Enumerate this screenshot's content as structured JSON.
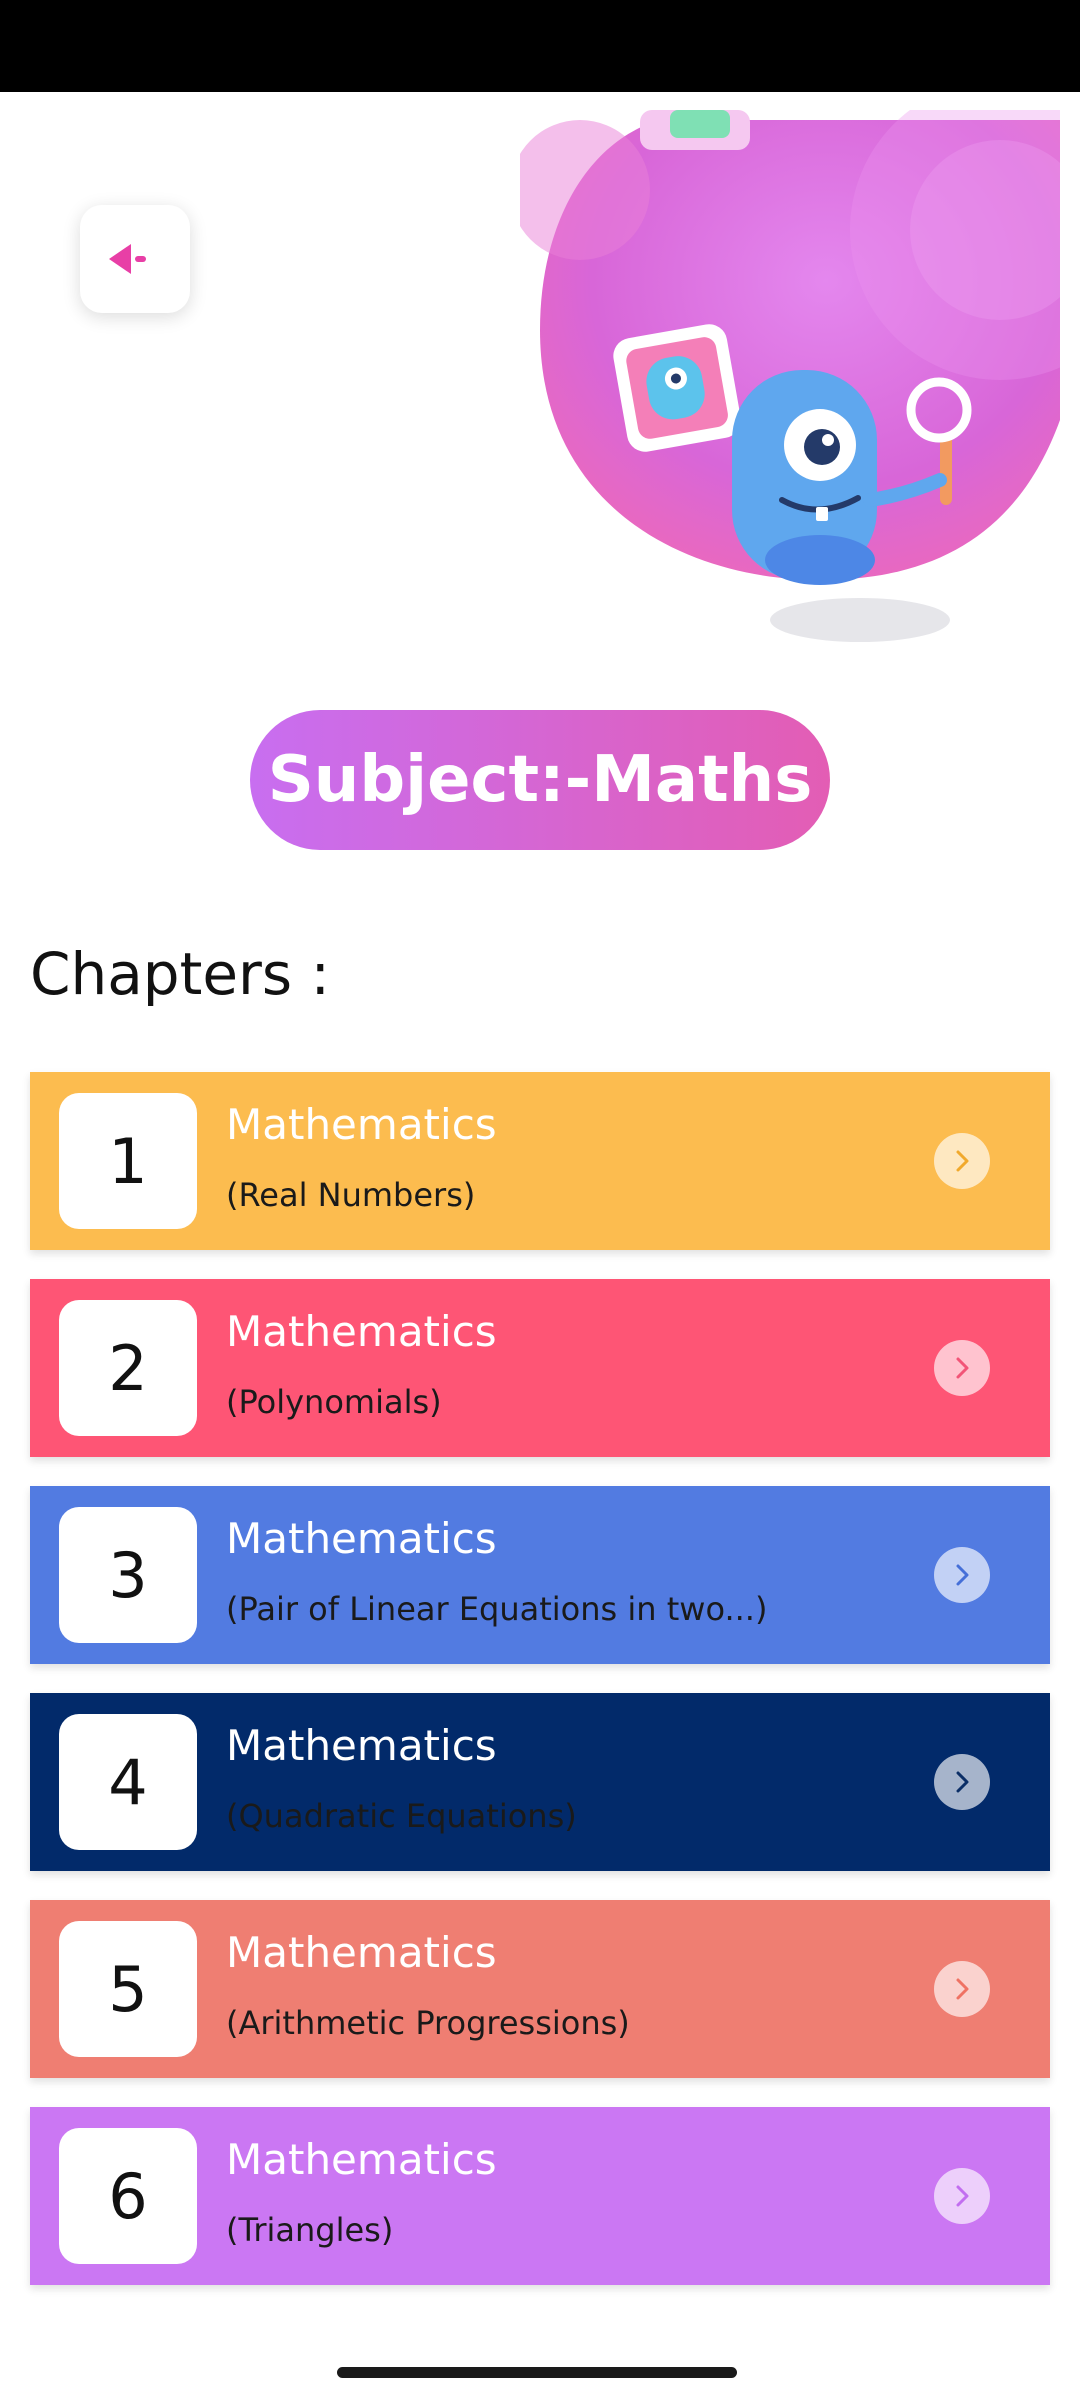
{
  "subject": {
    "label": "Subject:-Maths"
  },
  "chapters_heading": "Chapters :",
  "chapters": [
    {
      "number": "1",
      "title": "Mathematics",
      "subtitle": "(Real Numbers)",
      "color": "#fcbc4f",
      "arrow_color": "#f1a92c"
    },
    {
      "number": "2",
      "title": "Mathematics",
      "subtitle": "(Polynomials)",
      "color": "#fe5575",
      "arrow_color": "#f25477"
    },
    {
      "number": "3",
      "title": "Mathematics",
      "subtitle": "(Pair of Linear Equations in two...)",
      "color": "#527be1",
      "arrow_color": "#456fd8"
    },
    {
      "number": "4",
      "title": "Mathematics",
      "subtitle": "(Quadratic Equations)",
      "color": "#022a6a",
      "arrow_color": "#0b2e66"
    },
    {
      "number": "5",
      "title": "Mathematics",
      "subtitle": "(Arithmetic Progressions)",
      "color": "#ef7e72",
      "arrow_color": "#ef7263"
    },
    {
      "number": "6",
      "title": "Mathematics",
      "subtitle": "(Triangles)",
      "color": "#cb77f3",
      "arrow_color": "#c26ef0"
    }
  ],
  "icons": {
    "back": "back-arrow-icon",
    "chevron": "chevron-right-icon"
  },
  "colors": {
    "accent_pink": "#e35db4",
    "accent_purple": "#c86ef0"
  }
}
